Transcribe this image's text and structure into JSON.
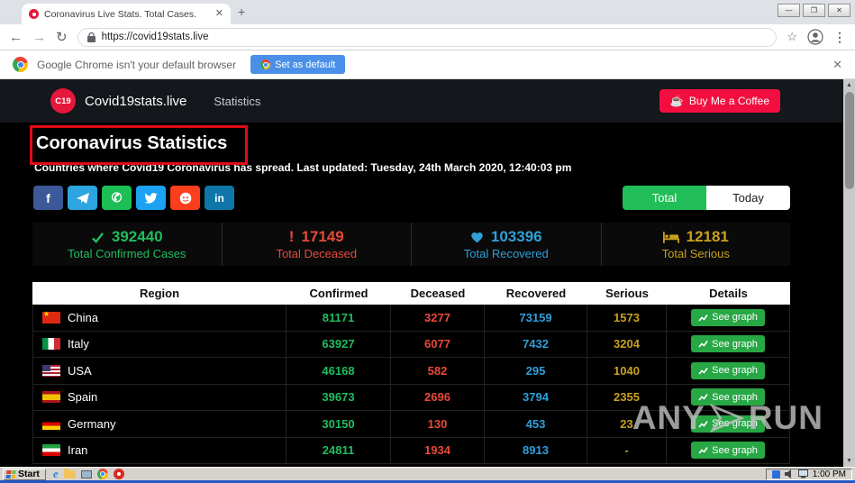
{
  "browser": {
    "tab_title": "Coronavirus Live Stats. Total Cases.",
    "url": "https://covid19stats.live",
    "infobar": {
      "message": "Google Chrome isn't your default browser",
      "button_label": "Set as default"
    }
  },
  "page": {
    "logo_text": "C19",
    "brand": "Covid19stats.live",
    "nav": {
      "statistics": "Statistics"
    },
    "coffee_button_label": "Buy Me a Coffee",
    "title": "Coronavirus Statistics",
    "subtitle": "Countries where Covid19 Coronavirus has spread. Last updated: Tuesday, 24th March 2020, 12:40:03 pm",
    "toggle": {
      "total_label": "Total",
      "today_label": "Today"
    },
    "stats": [
      {
        "value": "392440",
        "label": "Total Confirmed Cases",
        "color": "#20bd5f"
      },
      {
        "value": "17149",
        "label": "Total Deceased",
        "color": "#e8493b"
      },
      {
        "value": "103396",
        "label": "Total Recovered",
        "color": "#2f9fd8"
      },
      {
        "value": "12181",
        "label": "Total Serious",
        "color": "#c8a11d"
      }
    ],
    "social_networks": [
      "Facebook",
      "Telegram",
      "WhatsApp",
      "Twitter",
      "Reddit",
      "LinkedIn"
    ],
    "social_glyphs": {
      "facebook": "f",
      "linkedin": "in"
    },
    "table": {
      "headers": {
        "region": "Region",
        "confirmed": "Confirmed",
        "deceased": "Deceased",
        "recovered": "Recovered",
        "serious": "Serious",
        "details": "Details"
      },
      "see_graph_label": "See graph",
      "rows": [
        {
          "region": "China",
          "flag": "china",
          "confirmed": "81171",
          "deceased": "3277",
          "recovered": "73159",
          "serious": "1573"
        },
        {
          "region": "Italy",
          "flag": "italy",
          "confirmed": "63927",
          "deceased": "6077",
          "recovered": "7432",
          "serious": "3204"
        },
        {
          "region": "USA",
          "flag": "usa",
          "confirmed": "46168",
          "deceased": "582",
          "recovered": "295",
          "serious": "1040"
        },
        {
          "region": "Spain",
          "flag": "spain",
          "confirmed": "39673",
          "deceased": "2696",
          "recovered": "3794",
          "serious": "2355"
        },
        {
          "region": "Germany",
          "flag": "germany",
          "confirmed": "30150",
          "deceased": "130",
          "recovered": "453",
          "serious": "23"
        },
        {
          "region": "Iran",
          "flag": "iran",
          "confirmed": "24811",
          "deceased": "1934",
          "recovered": "8913",
          "serious": "-"
        }
      ]
    }
  },
  "watermark": {
    "left": "ANY",
    "right": "RUN"
  },
  "taskbar": {
    "start_label": "Start",
    "clock": "1:00 PM"
  }
}
